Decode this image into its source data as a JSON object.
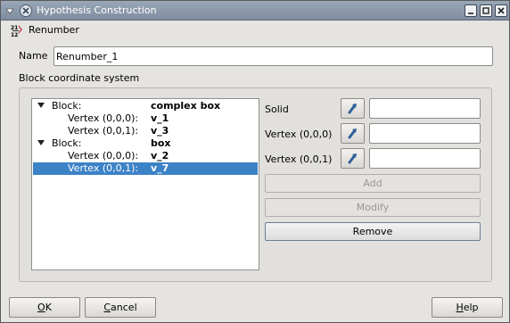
{
  "window": {
    "title": "Hypothesis Construction"
  },
  "header": {
    "label": "Renumber",
    "icon": "renumber-icon"
  },
  "name": {
    "label": "Name",
    "value": "Renumber_1"
  },
  "group": {
    "title": "Block coordinate system"
  },
  "tree": {
    "rows": [
      {
        "col1": "Block:",
        "col2": "complex box"
      },
      {
        "col1": "Vertex (0,0,0):",
        "col2": "v_1"
      },
      {
        "col1": "Vertex (0,0,1):",
        "col2": "v_3"
      },
      {
        "col1": "Block:",
        "col2": "box"
      },
      {
        "col1": "Vertex (0,0,0):",
        "col2": "v_2"
      },
      {
        "col1": "Vertex (0,0,1):",
        "col2": "v_7"
      }
    ],
    "selected_index": 5
  },
  "fields": [
    {
      "label": "Solid",
      "value": ""
    },
    {
      "label": "Vertex (0,0,0)",
      "value": ""
    },
    {
      "label": "Vertex (0,0,1)",
      "value": ""
    }
  ],
  "buttons": {
    "add": "Add",
    "modify": "Modify",
    "remove": "Remove",
    "ok_u": "O",
    "ok_rest": "K",
    "cancel_u": "C",
    "cancel_rest": "ancel",
    "help_u": "H",
    "help_rest": "elp"
  }
}
